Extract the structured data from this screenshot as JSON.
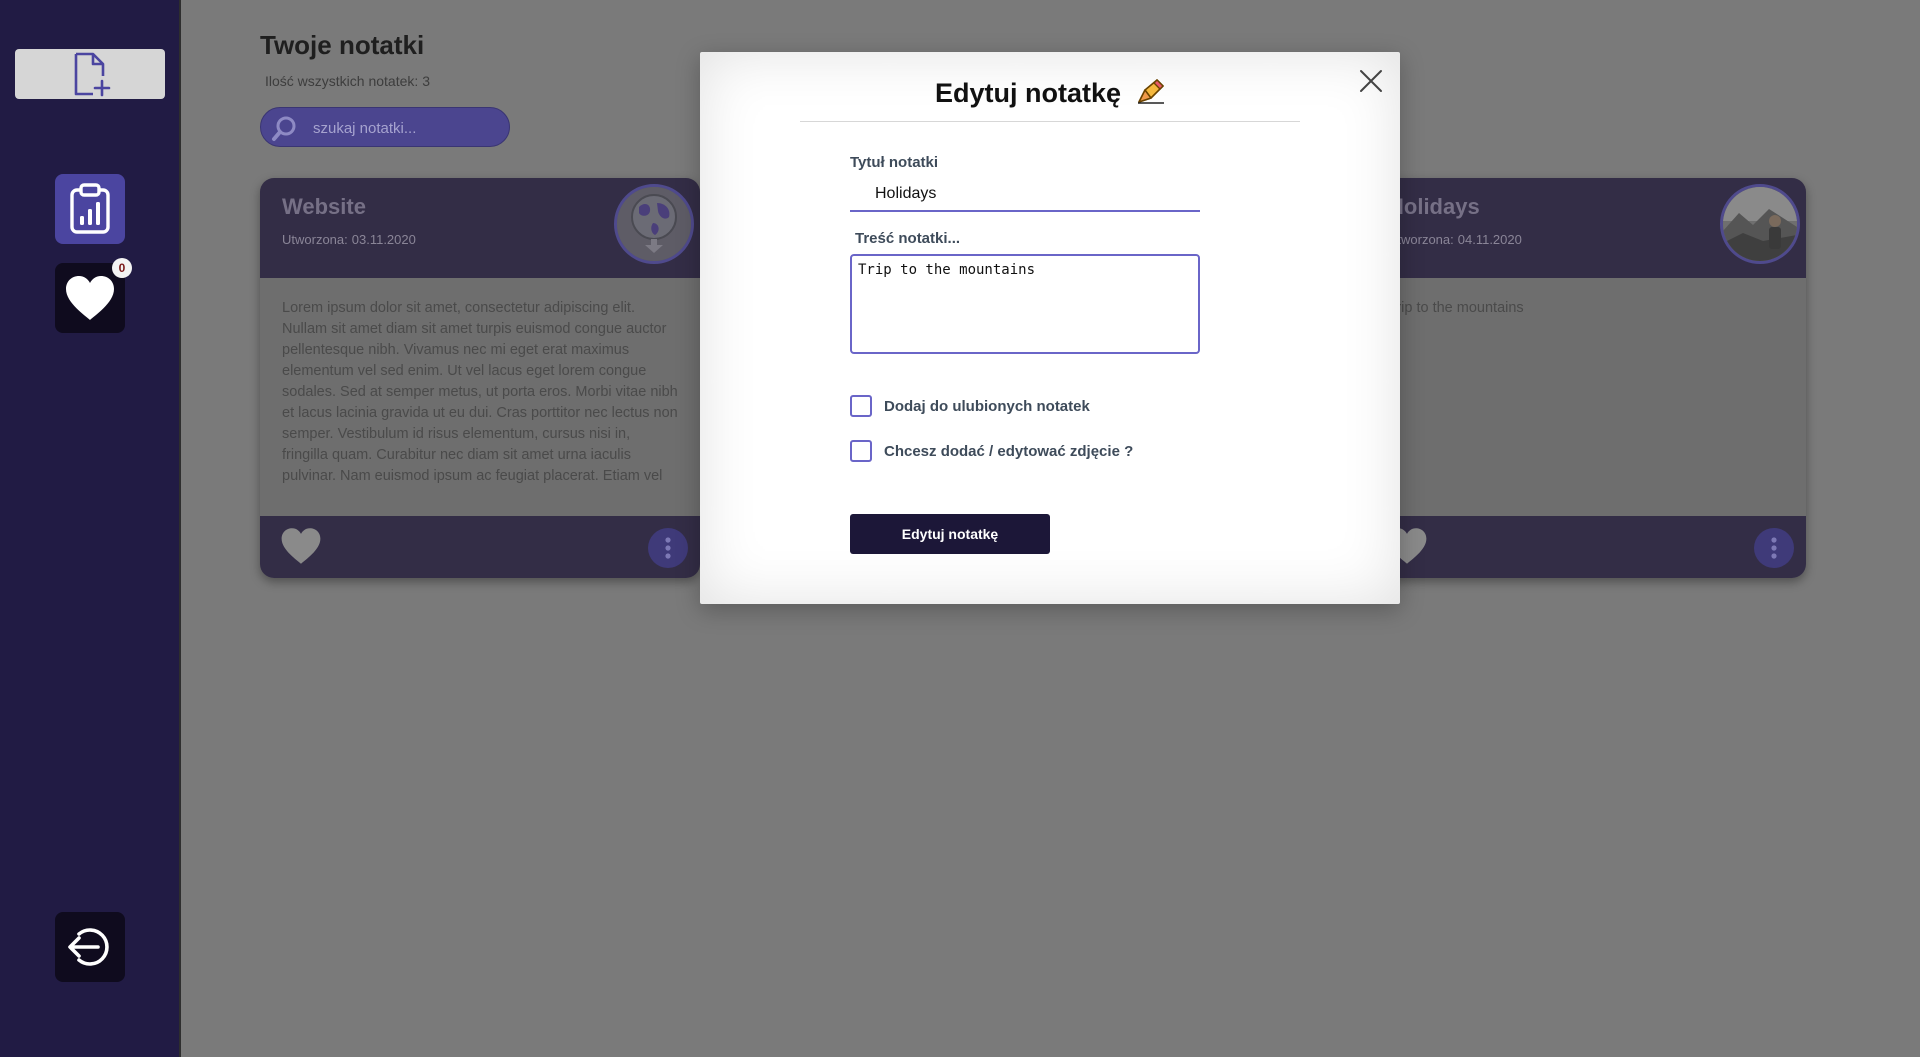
{
  "sidebar": {
    "favorites_badge": "0",
    "icons": {
      "new_note": "file-plus-icon",
      "stats": "clipboard-chart-icon",
      "favorites": "heart-icon",
      "logout": "logout-icon"
    }
  },
  "header": {
    "title": "Twoje notatki",
    "count_label": "Ilość wszystkich notatek:",
    "count_value": "3"
  },
  "search": {
    "placeholder": "szukaj notatki..."
  },
  "notes": [
    {
      "title": "Website",
      "created_label": "Utworzona:",
      "created_date": "03.11.2020",
      "body": "Lorem ipsum dolor sit amet, consectetur adipiscing elit. Nullam sit amet diam sit amet turpis euismod congue auctor pellentesque nibh. Vivamus nec mi eget erat maximus elementum vel sed enim. Ut vel lacus eget lorem congue sodales. Sed at semper metus, ut porta eros. Morbi vitae nibh et lacus lacinia gravida ut eu dui. Cras porttitor nec lectus non semper. Vestibulum id risus elementum, cursus nisi in, fringilla quam. Curabitur nec diam sit amet urna iaculis pulvinar. Nam euismod ipsum ac feugiat placerat. Etiam vel",
      "avatar": "globe-image"
    },
    {
      "title": "Holidays",
      "created_label": "Utworzona:",
      "created_date": "04.11.2020",
      "body": "Trip to the mountains",
      "avatar": "mountain-photo"
    }
  ],
  "modal": {
    "title": "Edytuj notatkę",
    "title_label": "Tytuł notatki",
    "title_value": "Holidays",
    "content_label": "Treść notatki...",
    "content_value": "Trip to the mountains",
    "favorite_checkbox_label": "Dodaj do ulubionych notatek",
    "photo_checkbox_label": "Chcesz dodać / edytować zdjęcie ?",
    "submit_label": "Edytuj notatkę"
  },
  "colors": {
    "sidebar_bg": "#211b44",
    "accent": "#6a65c8",
    "button_dark": "#1c1738",
    "overlay": "#7a7a7a"
  }
}
